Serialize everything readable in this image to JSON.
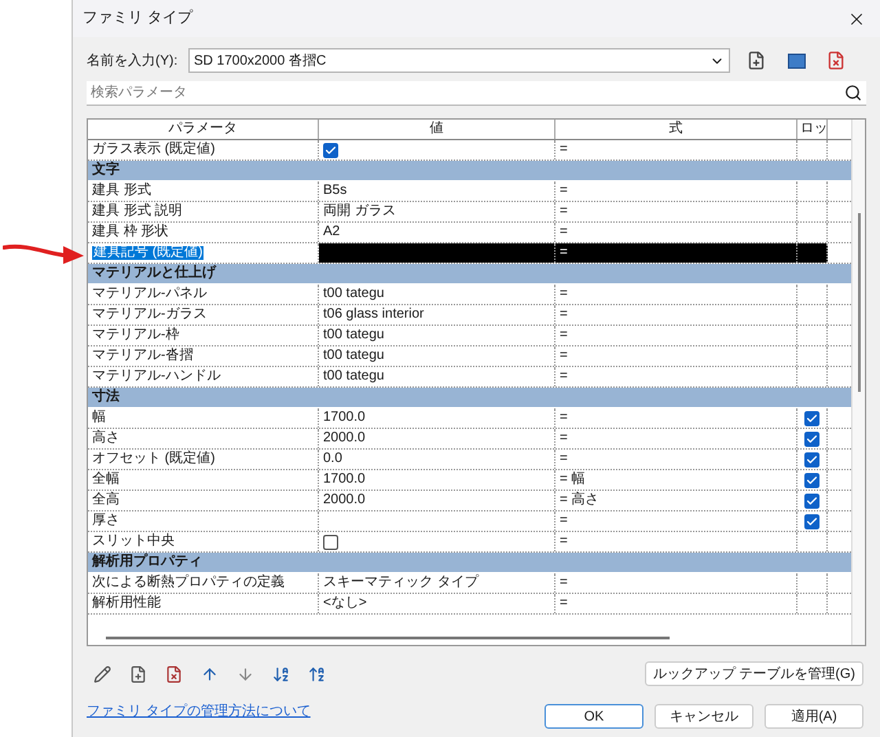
{
  "window": {
    "title": "ファミリ タイプ"
  },
  "name_field": {
    "label": "名前を入力(Y):",
    "value": "SD 1700x2000 沓摺C"
  },
  "search": {
    "placeholder": "検索パラメータ"
  },
  "table": {
    "columns": [
      "パラメータ",
      "値",
      "式",
      "ロッ"
    ],
    "rows": [
      {
        "kind": "checkbox_row",
        "parameter": "ガラス表示 (既定値)",
        "checked": true,
        "formula": "=",
        "selected": false
      },
      {
        "kind": "group",
        "label": "文字"
      },
      {
        "kind": "text_row",
        "parameter": "建具 形式",
        "value": "B5s",
        "formula": "=",
        "selected": false
      },
      {
        "kind": "text_row",
        "parameter": "建具 形式 説明",
        "value": "両開 ガラス",
        "formula": "=",
        "selected": false
      },
      {
        "kind": "text_row",
        "parameter": "建具 枠 形状",
        "value": "A2",
        "formula": "=",
        "selected": false
      },
      {
        "kind": "text_row",
        "parameter": "建具記号 (既定値)",
        "formula": "=",
        "selected": true
      },
      {
        "kind": "group",
        "label": "マテリアルと仕上げ"
      },
      {
        "kind": "text_row",
        "parameter": "マテリアル-パネル",
        "value": "t00 tategu",
        "formula": "=",
        "selected": false
      },
      {
        "kind": "text_row",
        "parameter": "マテリアル-ガラス",
        "value": "t06 glass interior",
        "formula": "=",
        "selected": false
      },
      {
        "kind": "text_row",
        "parameter": "マテリアル-枠",
        "value": "t00 tategu",
        "formula": "=",
        "selected": false
      },
      {
        "kind": "text_row",
        "parameter": "マテリアル-沓摺",
        "value": "t00 tategu",
        "formula": "=",
        "selected": false
      },
      {
        "kind": "text_row",
        "parameter": "マテリアル-ハンドル",
        "value": "t00 tategu",
        "formula": "=",
        "selected": false
      },
      {
        "kind": "group",
        "label": "寸法"
      },
      {
        "kind": "text_row",
        "parameter": "幅",
        "value": "1700.0",
        "formula": "=",
        "locked": true,
        "selected": false
      },
      {
        "kind": "text_row",
        "parameter": "高さ",
        "value": "2000.0",
        "formula": "=",
        "locked": true,
        "selected": false
      },
      {
        "kind": "text_row",
        "parameter": "オフセット (既定値)",
        "value": "0.0",
        "formula": "=",
        "locked": true,
        "selected": false
      },
      {
        "kind": "text_row",
        "parameter": "全幅",
        "value": "1700.0",
        "formula": "= 幅",
        "locked": true,
        "selected": false
      },
      {
        "kind": "text_row",
        "parameter": "全高",
        "value": "2000.0",
        "formula": "= 高さ",
        "locked": true,
        "selected": false
      },
      {
        "kind": "text_row",
        "parameter": "厚さ",
        "formula": "=",
        "locked": true,
        "selected": false
      },
      {
        "kind": "checkbox_row",
        "parameter": "スリット中央",
        "checked": false,
        "formula": "=",
        "selected": false
      },
      {
        "kind": "group",
        "label": "解析用プロパティ"
      },
      {
        "kind": "text_row",
        "parameter": "次による断熱プロパティの定義",
        "value": "スキーマティック タイプ",
        "formula": "=",
        "selected": false
      },
      {
        "kind": "text_row",
        "parameter": "解析用性能",
        "value": "<なし>",
        "formula": "=",
        "selected": false
      }
    ]
  },
  "lookup_button": "ルックアップ テーブルを管理(G)",
  "help_link": "ファミリ タイプの管理方法について",
  "buttons": [
    {
      "label": "OK",
      "default": true
    },
    {
      "label": "キャンセル",
      "default": false
    },
    {
      "label": "適用(A)",
      "default": false
    }
  ]
}
